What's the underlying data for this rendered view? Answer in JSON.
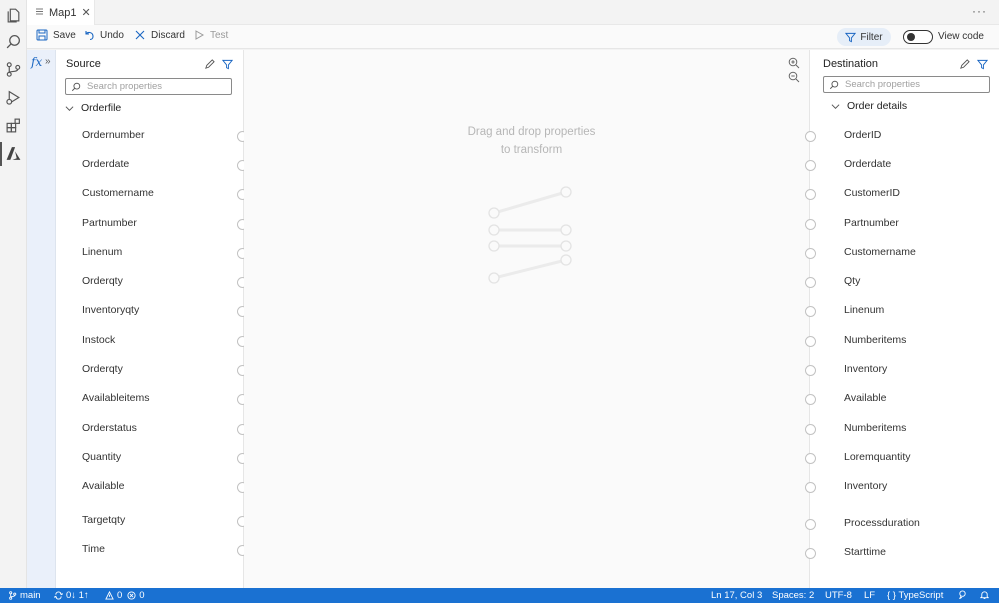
{
  "window": {
    "more_label": "···"
  },
  "tab": {
    "title": "Map1",
    "close": "✕"
  },
  "activity_bar": {
    "icons": [
      "explorer-icon",
      "search-icon",
      "source-control-icon",
      "run-debug-icon",
      "extensions-icon",
      "azure-icon"
    ],
    "active": "azure-icon"
  },
  "toolbar": {
    "save": "Save",
    "undo": "Undo",
    "discard": "Discard",
    "test": "Test",
    "filter": "Filter",
    "view_code": "View code",
    "view_code_on": false
  },
  "fx": {
    "label": "fx",
    "expand": "»"
  },
  "source": {
    "title": "Source",
    "search_placeholder": "Search properties",
    "group": "Orderfile",
    "properties": [
      "Ordernumber",
      "Orderdate",
      "Customername",
      "Partnumber",
      "Linenum",
      "Orderqty",
      "Inventoryqty",
      "Instock",
      "Orderqty",
      "Availableitems",
      "Orderstatus",
      "Quantity",
      "Available",
      "Targetqty",
      "Time"
    ]
  },
  "canvas": {
    "hint_line1": "Drag and drop properties",
    "hint_line2": "to transform"
  },
  "destination": {
    "title": "Destination",
    "search_placeholder": "Search properties",
    "group": "Order details",
    "properties": [
      "OrderID",
      "Orderdate",
      "CustomerID",
      "Partnumber",
      "Customername",
      "Qty",
      "Linenum",
      "Numberitems",
      "Inventory",
      "Available",
      "Numberitems",
      "Loremquantity",
      "Inventory",
      "Processduration",
      "Starttime"
    ]
  },
  "status_bar": {
    "branch": "main",
    "sync": "0↓ 1↑",
    "warnings": "0",
    "errors": "0",
    "position": "Ln 17, Col 3",
    "spaces": "Spaces: 2",
    "encoding": "UTF-8",
    "eol": "LF",
    "language": "{ } TypeScript"
  },
  "colors": {
    "accent": "#1a71d2",
    "filter_bg": "#e6eef8",
    "fx_strip": "#eaf0fa"
  }
}
